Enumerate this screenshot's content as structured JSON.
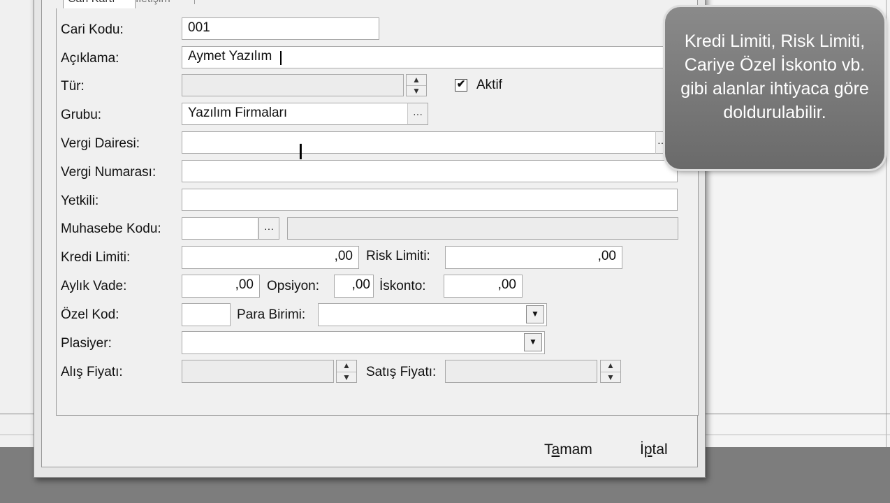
{
  "tabs": {
    "cari": "Cari Kartı",
    "iletisim": "İletişim"
  },
  "form": {
    "cari_kodu": {
      "label": "Cari Kodu:",
      "value": "001"
    },
    "aciklama": {
      "label": "Açıklama:",
      "value": "Aymet Yazılım"
    },
    "tur": {
      "label": "Tür:",
      "value": ""
    },
    "aktif": {
      "label": "Aktif",
      "checked": true,
      "mark": "✔"
    },
    "grubu": {
      "label": "Grubu:",
      "value": "Yazılım Firmaları"
    },
    "vergi_dairesi": {
      "label": "Vergi Dairesi:",
      "value": ""
    },
    "vergi_numarasi": {
      "label": "Vergi Numarası:",
      "value": ""
    },
    "yetkili": {
      "label": "Yetkili:",
      "value": ""
    },
    "muhasebe_kodu": {
      "label": "Muhasebe Kodu:",
      "value": ""
    },
    "kredi_limiti": {
      "label": "Kredi Limiti:",
      "value": ",00"
    },
    "risk_limiti": {
      "label": "Risk Limiti:",
      "value": ",00"
    },
    "aylik_vade": {
      "label": "Aylık Vade:",
      "value": ",00"
    },
    "opsiyon": {
      "label": "Opsiyon:",
      "value": ",00"
    },
    "iskonto": {
      "label": "İskonto:",
      "value": ",00"
    },
    "ozel_kod": {
      "label": "Özel Kod:",
      "value": ""
    },
    "para_birimi": {
      "label": "Para Birimi:",
      "value": ""
    },
    "plasiyer": {
      "label": "Plasiyer:",
      "value": ""
    },
    "alis_fiyati": {
      "label": "Alış Fiyatı:",
      "value": ""
    },
    "satis_fiyati": {
      "label": "Satış Fiyatı:",
      "value": ""
    }
  },
  "buttons": {
    "ellipsis": "···",
    "spin_up": "▲",
    "spin_down": "▼",
    "dropdown": "▼",
    "ok_prefix": "T",
    "ok_ul": "a",
    "ok_suffix": "mam",
    "cancel_prefix": "İ",
    "cancel_ul": "p",
    "cancel_suffix": "tal"
  },
  "callout": {
    "text": "Kredi Limiti, Risk Limiti, Cariye Özel İskonto vb. gibi alanlar ihtiyaca göre doldurulabilir."
  },
  "cursor_glyph": "I",
  "colors": {
    "callout_bg": "#7a7a7a",
    "bottom_band": "#7d7d7d"
  }
}
